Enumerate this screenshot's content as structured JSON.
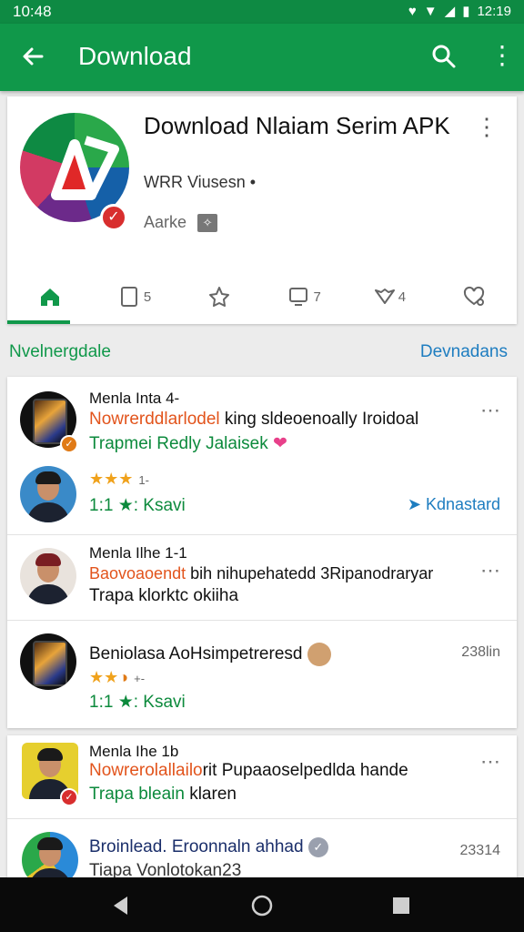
{
  "status": {
    "time": "10:48",
    "clock_right": "12:19"
  },
  "appbar": {
    "title": "Download"
  },
  "app": {
    "title": "Download Nlaiam Serim APK",
    "subtitle": "WRR Viusesn",
    "meta": "Aarke"
  },
  "tabs": [
    {
      "icon": "home-icon",
      "count": ""
    },
    {
      "icon": "tablet-icon",
      "count": "5"
    },
    {
      "icon": "star-icon",
      "count": ""
    },
    {
      "icon": "monitor-icon",
      "count": "7"
    },
    {
      "icon": "heart-outline-icon",
      "count": "4"
    },
    {
      "icon": "heart-check-icon",
      "count": ""
    }
  ],
  "section": {
    "left": "Nvelnergdale",
    "right": "Devnadans"
  },
  "items": [
    {
      "name": "Menla Inta 4-",
      "line1_red": "Nowrerddlarlodel",
      "line1_rest": " king sldeoenoally Iroidoal",
      "line2": "Trapmei Redly Jalaisek",
      "stars": "★★★",
      "stars_extra": "1-",
      "count": "1:1 ★: Ksavi",
      "link": "Kdnastard"
    },
    {
      "name": "Menla Ilhe 1-1",
      "line1_red": "Baovoaoendt",
      "line1_rest": " bih nihupehatedd 3Ripanodraryar",
      "line2": "Trapa klorktc okiiha"
    },
    {
      "title": "Beniolasa AoHsimpetreresd",
      "stars": "★★",
      "stars_extra": "+-",
      "count": "1:1 ★: Ksavi",
      "size": "238lin"
    },
    {
      "name": "Menla Ihe 1b",
      "line1_red": "Nowrerolallailo",
      "line1_rest": "rit Pupaaoselpedlda hande",
      "line2_green": "Trapa bleain",
      "line2_rest": " klaren"
    },
    {
      "title": "Broinlead. Eroonnaln ahhad",
      "line2": "Tiapa Vonlotokan23",
      "size": "23314"
    }
  ],
  "colors": {
    "primary": "#10984a",
    "status": "#0e8a43",
    "link": "#1e7dc0",
    "accent_red": "#e2541c",
    "star": "#f0a21c"
  }
}
